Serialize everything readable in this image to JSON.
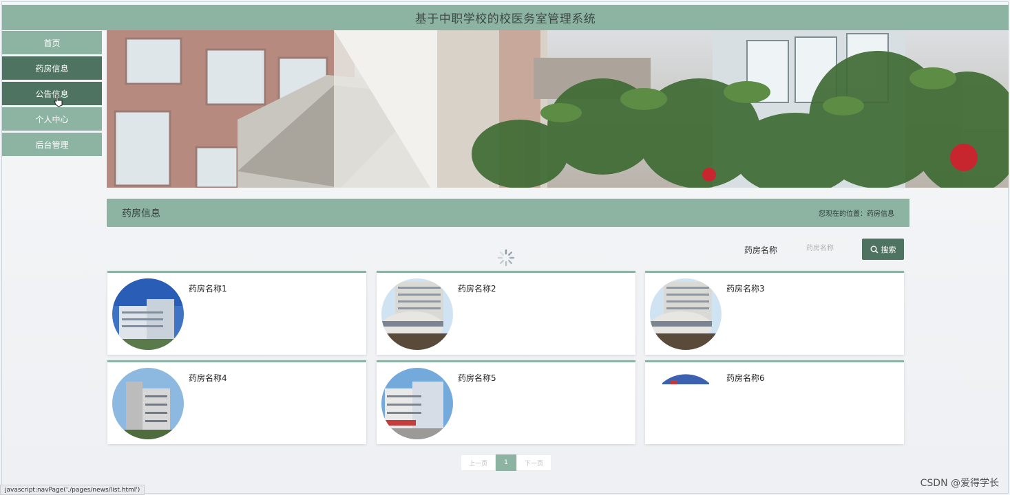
{
  "app": {
    "title": "基于中职学校的校医务室管理系统"
  },
  "sidebar": {
    "items": [
      {
        "label": "首页"
      },
      {
        "label": "药房信息"
      },
      {
        "label": "公告信息"
      },
      {
        "label": "个人中心"
      },
      {
        "label": "后台管理"
      }
    ]
  },
  "section": {
    "title": "药房信息",
    "breadcrumb": "您现在的位置：药房信息"
  },
  "search": {
    "label": "药房名称",
    "placeholder": "药房名称",
    "button_label": "搜索"
  },
  "cards": [
    {
      "name": "药房名称1"
    },
    {
      "name": "药房名称2"
    },
    {
      "name": "药房名称3"
    },
    {
      "name": "药房名称4"
    },
    {
      "name": "药房名称5"
    },
    {
      "name": "药房名称6"
    }
  ],
  "pagination": {
    "prev": "上一页",
    "current": "1",
    "next": "下一页"
  },
  "status_bar": {
    "text": "javascript:navPage('./pages/news/list.html')"
  },
  "watermark": "CSDN @爱得学长",
  "colors": {
    "primary": "#8db4a3",
    "dark": "#4e7360"
  }
}
